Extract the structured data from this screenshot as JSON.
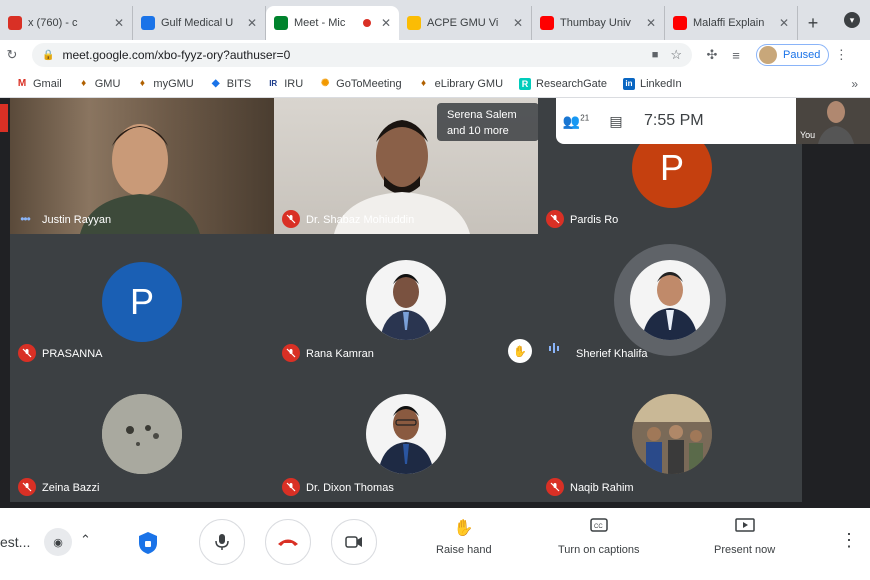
{
  "browser": {
    "tabs": [
      {
        "title": "x (760) - c",
        "favicon_color": "#d93025",
        "active": false
      },
      {
        "title": "Gulf Medical U",
        "favicon_color": "#1a73e8",
        "active": false
      },
      {
        "title": "Meet - Mic",
        "favicon_color": "#00832d",
        "active": true
      },
      {
        "title": "ACPE GMU Vi",
        "favicon_color": "#fbbc04",
        "active": false
      },
      {
        "title": "Thumbay Univ",
        "favicon_color": "#ff0000",
        "active": false
      },
      {
        "title": "Malaffi Explain",
        "favicon_color": "#ff0000",
        "active": false
      }
    ],
    "url": "meet.google.com/xbo-fyyz-ory?authuser=0",
    "profile_status": "Paused",
    "bookmarks": [
      {
        "label": "Gmail",
        "icon": "M",
        "color": "#d93025"
      },
      {
        "label": "GMU",
        "icon": "♦",
        "color": "#b06000"
      },
      {
        "label": "myGMU",
        "icon": "♦",
        "color": "#b06000"
      },
      {
        "label": "BITS",
        "icon": "◆",
        "color": "#1a73e8"
      },
      {
        "label": "IRU",
        "icon": "IR",
        "color": "#1a3a8a"
      },
      {
        "label": "GoToMeeting",
        "icon": "✺",
        "color": "#f29900"
      },
      {
        "label": "eLibrary GMU",
        "icon": "♦",
        "color": "#b06000"
      },
      {
        "label": "ResearchGate",
        "icon": "R",
        "color": "#00ccbb"
      },
      {
        "label": "LinkedIn",
        "icon": "in",
        "color": "#0a66c2"
      }
    ]
  },
  "meet": {
    "participant_count": "21",
    "time": "7:55 PM",
    "self_label": "You",
    "overflow": {
      "line1": "Serena Salem",
      "line2": "and 10 more"
    },
    "tiles": [
      {
        "name": "Justin Rayyan",
        "kind": "video",
        "muted": false
      },
      {
        "name": "Dr. Shabaz Mohiuddin",
        "kind": "video",
        "muted": true
      },
      {
        "name": "Pardis Ro",
        "kind": "avatar",
        "letter": "P",
        "color": "#c5400f",
        "muted": true
      },
      {
        "name": "PRASANNA",
        "kind": "avatar",
        "letter": "P",
        "color": "#1a5fb4",
        "muted": true
      },
      {
        "name": "Rana Kamran",
        "kind": "photo",
        "muted": true
      },
      {
        "name": "Sherief Khalifa",
        "kind": "photo",
        "muted": false,
        "speaking": true,
        "hand_raised": true
      },
      {
        "name": "Zeina Bazzi",
        "kind": "photo",
        "muted": true
      },
      {
        "name": "Dr. Dixon Thomas",
        "kind": "photo",
        "muted": true
      },
      {
        "name": "Naqib Rahim",
        "kind": "photo",
        "muted": true
      }
    ]
  },
  "controls": {
    "meeting_code": "est...",
    "raise_hand": "Raise hand",
    "captions": "Turn on captions",
    "present": "Present now"
  }
}
